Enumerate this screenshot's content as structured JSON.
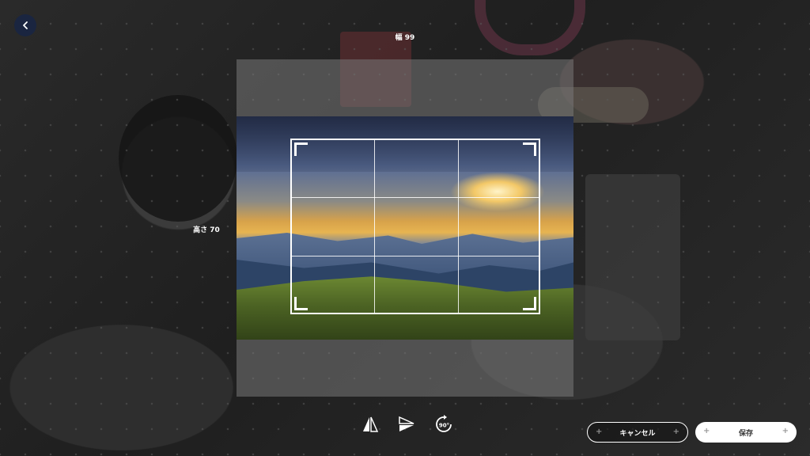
{
  "header": {
    "back_icon": "chevron-left-icon"
  },
  "crop": {
    "width_label": "幅 99",
    "height_label": "高さ 70"
  },
  "tools": {
    "flip_horizontal_icon": "flip-horizontal-icon",
    "flip_vertical_icon": "flip-vertical-icon",
    "rotate_icon": "rotate-90-icon",
    "rotate_label": "90°"
  },
  "actions": {
    "cancel_label": "キャンセル",
    "save_label": "保存"
  },
  "colors": {
    "back_button_bg": "#1a2540",
    "save_button_bg": "#ffffff",
    "cancel_button_border": "#ffffff"
  }
}
